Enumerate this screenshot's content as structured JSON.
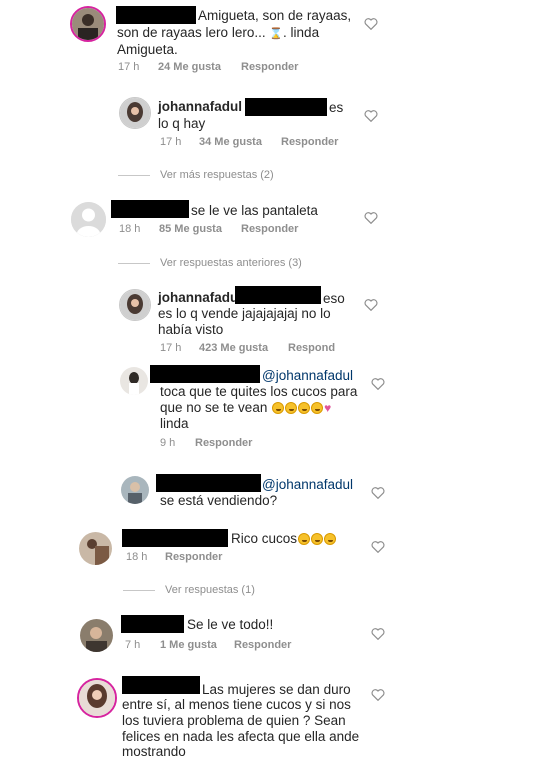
{
  "comments": [
    {
      "text_lines": [
        "Amigueta, son de rayaas,",
        "son de rayaas lero lero... ",
        "Amigueta."
      ],
      "inline_glyph": "⌛",
      "after_glyph": ". linda",
      "time": "17 h",
      "likes": "24 Me gusta",
      "reply": "Responder"
    },
    {
      "username": "johannafadul",
      "text_after": "es",
      "text_line2": "lo q hay",
      "time": "17 h",
      "likes": "34 Me gusta",
      "reply": "Responder"
    },
    {
      "more": "Ver más respuestas (2)"
    },
    {
      "text": "se le ve las pantaleta",
      "time": "18 h",
      "likes": "85 Me gusta",
      "reply": "Responder"
    },
    {
      "more": "Ver respuestas anteriores (3)"
    },
    {
      "username": "johannafadul",
      "text_after": "eso",
      "text_line2": "es lo q vende jajajajajaj no lo",
      "text_line3": "había visto",
      "time": "17 h",
      "likes": "423 Me gusta",
      "reply": "Respond"
    },
    {
      "mention": "@johannafadul",
      "text_line1": "toca que te quites los cucos para",
      "text_line2": "que no se te vean",
      "text_line3": "linda",
      "time": "9 h",
      "reply": "Responder"
    },
    {
      "mention": "@johannafadul",
      "text_line1": "se está vendiendo?"
    },
    {
      "text": "Rico cucos",
      "time": "18 h",
      "reply": "Responder"
    },
    {
      "more": "Ver respuestas (1)"
    },
    {
      "text": "Se le ve todo!!",
      "time": "7 h",
      "likes": "1 Me gusta",
      "reply": "Responder"
    },
    {
      "text_line1": "Las mujeres se dan duro",
      "text_line2": "entre sí, al menos tiene cucos y si nos",
      "text_line3": "los tuviera problema de quien ? Sean",
      "text_line4": "felices en nada les afecta que ella ande",
      "text_line5": "mostrando"
    }
  ],
  "icons": {
    "like": "heart-outline-icon"
  },
  "colors": {
    "text": "#262626",
    "meta": "#8e8e8e",
    "redaction": "#000000"
  }
}
